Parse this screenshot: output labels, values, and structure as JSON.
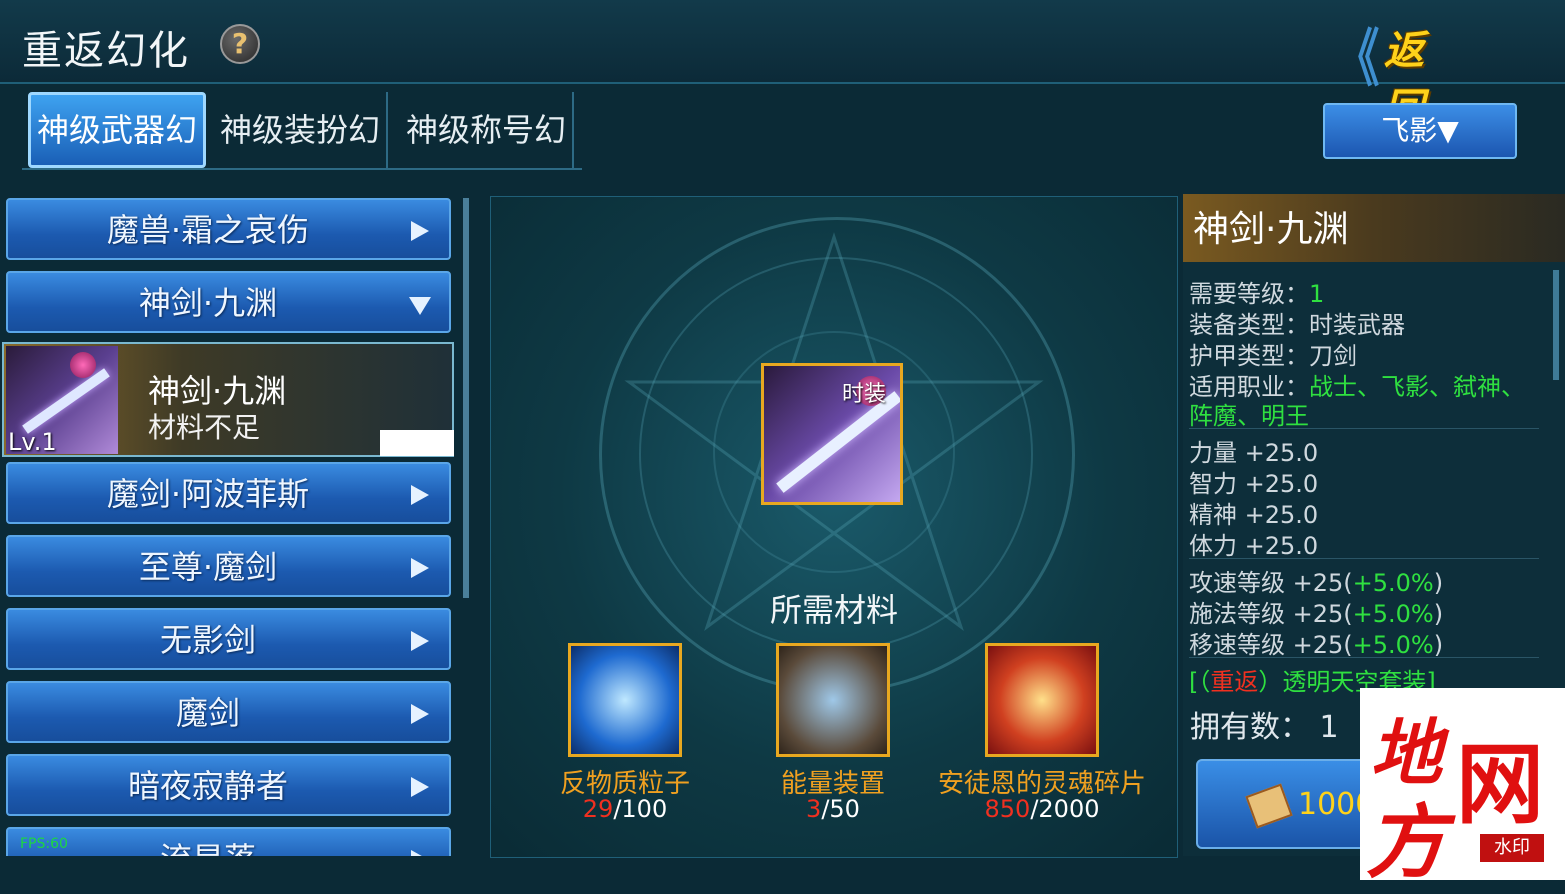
{
  "header": {
    "title": "重返幻化",
    "help_icon": "?",
    "back_label": "返回"
  },
  "tabs": [
    {
      "label": "神级武器幻",
      "active": true
    },
    {
      "label": "神级装扮幻",
      "active": false
    },
    {
      "label": "神级称号幻",
      "active": false
    }
  ],
  "job_select": {
    "value": "飞影"
  },
  "list": {
    "items": [
      {
        "label": "魔兽·霜之哀伤",
        "expanded": false
      },
      {
        "label": "神剑·九渊",
        "expanded": true
      },
      {
        "label": "魔剑·阿波菲斯",
        "expanded": false
      },
      {
        "label": "至尊·魔剑",
        "expanded": false
      },
      {
        "label": "无影剑",
        "expanded": false
      },
      {
        "label": "魔剑",
        "expanded": false
      },
      {
        "label": "暗夜寂静者",
        "expanded": false
      },
      {
        "label": "流星落",
        "expanded": false
      }
    ],
    "sub_item": {
      "level": "Lv.1",
      "name": "神剑·九渊",
      "status": "材料不足"
    }
  },
  "fps": "FPS:60",
  "center": {
    "weapon_tag": "时装",
    "materials_title": "所需材料",
    "materials": [
      {
        "name": "反物质粒子",
        "have": "29",
        "need": "/100"
      },
      {
        "name": "能量装置",
        "have": "3",
        "need": "/50"
      },
      {
        "name": "安徒恩的灵魂碎片",
        "have": "850",
        "need": "/2000"
      }
    ]
  },
  "details": {
    "title": "神剑·九渊",
    "req_level_label": "需要等级：",
    "req_level": "1",
    "equip_type_label": "装备类型：",
    "equip_type": "时装武器",
    "armor_type_label": "护甲类型：",
    "armor_type": "刀剑",
    "jobs_label": "适用职业：",
    "jobs_line1": "战士、飞影、弑神、",
    "jobs_line2": "阵魔、明王",
    "stats": [
      "力量 +25.0",
      "智力 +25.0",
      "精神 +25.0",
      "体力 +25.0"
    ],
    "speed_stats": [
      {
        "label": "攻速等级 +25(",
        "pct": "+5.0%",
        "close": ")"
      },
      {
        "label": "施法等级 +25(",
        "pct": "+5.0%",
        "close": ")"
      },
      {
        "label": "移速等级 +25(",
        "pct": "+5.0%",
        "close": ")"
      }
    ],
    "set_open": "[（",
    "set_red": "重返",
    "set_rest": "）透明天空套装]",
    "owned": "拥有数：  1",
    "craft_cost": "1000"
  },
  "watermark": {
    "c1": "地",
    "c2": "网",
    "c3": "方",
    "badge": "水印"
  },
  "colors": {
    "accent_blue": "#1c5ab0",
    "gold": "#e8a820",
    "green": "#2fe040",
    "red": "#f03020"
  }
}
